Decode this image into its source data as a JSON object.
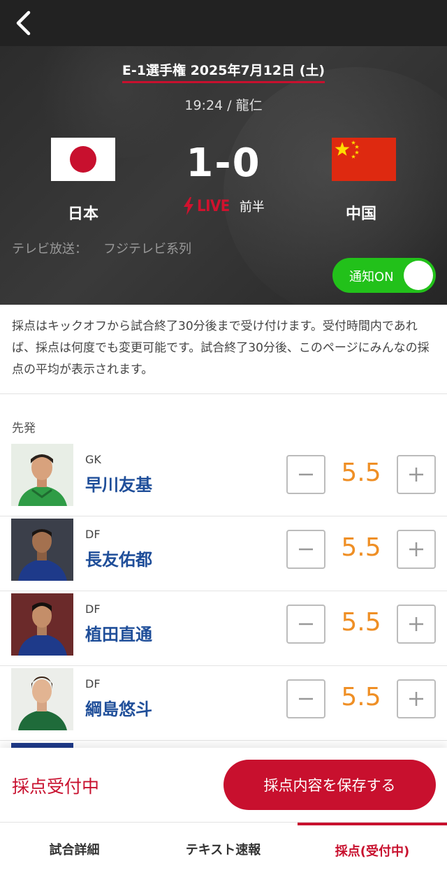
{
  "match": {
    "title": "E-1選手権 2025年7月12日 (土)",
    "subtitle": "19:24 / 龍仁",
    "home_team": "日本",
    "away_team": "中国",
    "score": "1-0",
    "live_label": "LIVE",
    "period": "前半",
    "tv_label": "テレビ放送：",
    "tv_channel": "フジテレビ系列",
    "notify_label": "通知ON",
    "notify_on": true
  },
  "notice": "採点はキックオフから試合終了30分後まで受け付けます。受付時間内であれば、採点は何度でも変更可能です。試合終了30分後、このページにみんなの採点の平均が表示されます。",
  "section_label": "先発",
  "players": [
    {
      "position": "GK",
      "name": "早川友基",
      "rating": "5.5"
    },
    {
      "position": "DF",
      "name": "長友佑都",
      "rating": "5.5"
    },
    {
      "position": "DF",
      "name": "植田直通",
      "rating": "5.5"
    },
    {
      "position": "DF",
      "name": "綱島悠斗",
      "rating": "5.5"
    }
  ],
  "footer": {
    "status": "採点受付中",
    "save_label": "採点内容を保存する"
  },
  "tabs": [
    {
      "label": "試合詳細",
      "active": false
    },
    {
      "label": "テキスト速報",
      "active": false
    },
    {
      "label": "採点(受付中)",
      "active": true
    }
  ],
  "colors": {
    "accent_red": "#c8102e",
    "rating_orange": "#ef8f25",
    "toggle_green": "#22c11a",
    "player_name_blue": "#1f4e99"
  },
  "icons": [
    "back-arrow-icon",
    "lightning-icon",
    "minus-icon",
    "plus-icon"
  ]
}
